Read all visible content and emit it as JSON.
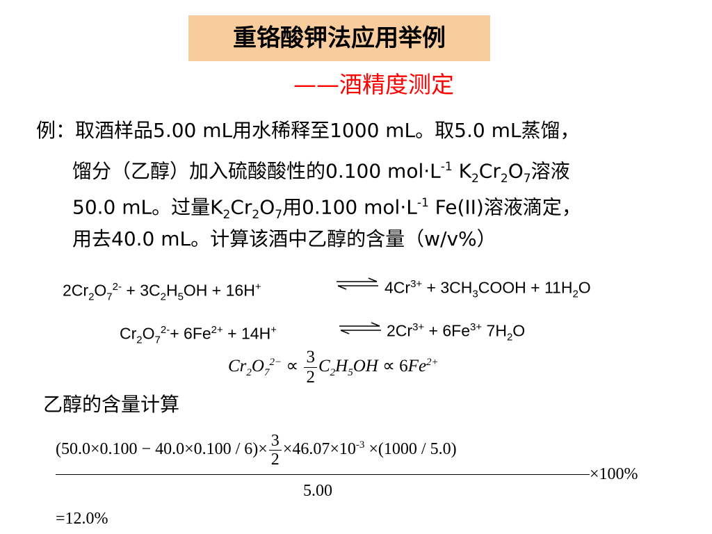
{
  "title": "重铬酸钾法应用举例",
  "subtitle": "——酒精度测定",
  "problem": {
    "p1": "例：取酒样品5.00 mL用水稀释至1000 mL。取5.0 mL蒸馏，",
    "p2_a": "馏分（乙醇）加入硫酸酸性的0.100 mol·L",
    "p2_exp": "-1",
    "p2_b": " K",
    "p2_c": "Cr",
    "p2_d": "O",
    "p2_e": "溶液",
    "sub2": "2",
    "sub7": "7",
    "p3_a": "50.0 mL。过量K",
    "p3_b": "用0.100 mol·L",
    "p3_c": " Fe(II)溶液滴定，",
    "p4": "用去40.0 mL。计算该酒中乙醇的含量（w/v%）"
  },
  "equations": {
    "eq1_left": {
      "t1": "2Cr",
      "s1": "2",
      "t2": "O",
      "s2": "7",
      "sup1": "2-",
      "t3": " + 3C",
      "s3": "2",
      "t4": "H",
      "s4": "5",
      "t5": "OH + 16H",
      "sup2": "+"
    },
    "eq1_right": {
      "t1": "4Cr",
      "sup1": "3+",
      "t2": " + 3CH",
      "s1": "3",
      "t3": "COOH + 11H",
      "s2": "2",
      "t4": "O"
    },
    "eq2_left": {
      "t1": "Cr",
      "s1": "2",
      "t2": "O",
      "s2": "7",
      "sup1": "2-",
      "t3": "+ 6Fe",
      "sup2": "2+",
      "t4": " + 14H",
      "sup3": "+"
    },
    "eq2_right": {
      "t1": "2Cr",
      "sup1": "3+",
      "t2": " + 6Fe",
      "sup2": "3+",
      "t3": " 7H",
      "s1": "2",
      "t4": "O"
    }
  },
  "ratio": {
    "t1": "Cr",
    "s1": "2",
    "t2": "O",
    "s2": "7",
    "sup1": "2−",
    "prop": " ∝ ",
    "num": "3",
    "den": "2",
    "t3": "C",
    "s3": "2",
    "t4": "H",
    "s4": "5",
    "t5": "OH",
    "prop2": " ∝ 6",
    "t6": "Fe",
    "sup2": "2+"
  },
  "calc_label": "乙醇的含量计算",
  "calc": {
    "part1": "(50.0×0.100 − 40.0×0.100 / 6)×",
    "frac_num": "3",
    "frac_den": "2",
    "part2": "×46.07×10",
    "exp": "-3",
    "part3": " ×(1000 / 5.0)",
    "times100": "×100%",
    "denominator": "5.00"
  },
  "result": "=12.0%"
}
